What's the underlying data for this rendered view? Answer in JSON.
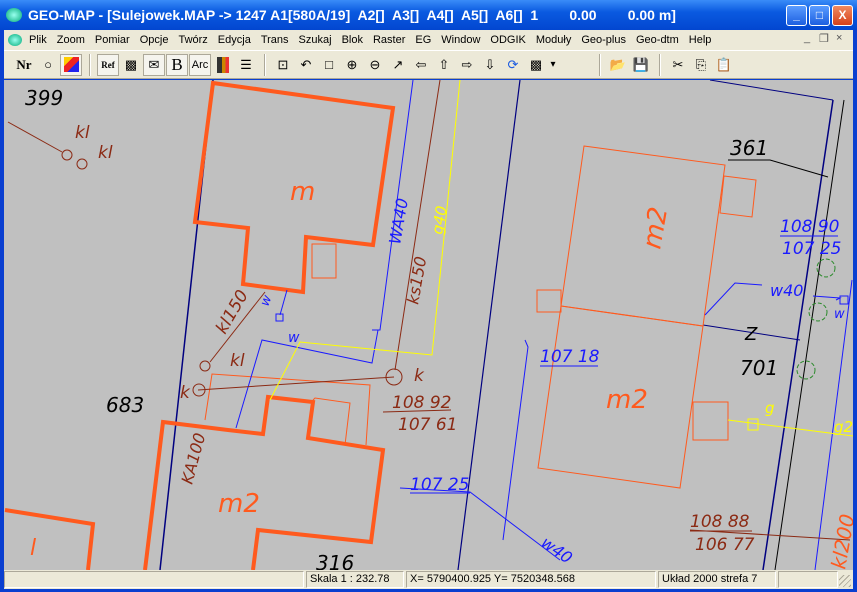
{
  "window": {
    "title": "GEO-MAP - [Sulejowek.MAP -> 1247 A1[580A/19]  A2[]  A3[]  A4[]  A5[]  A6[]  1        0.00        0.00 m]",
    "minimize": "_",
    "maximize": "□",
    "close": "X"
  },
  "menu": {
    "items": [
      "Plik",
      "Zoom",
      "Pomiar",
      "Opcje",
      "Twórz",
      "Edycja",
      "Trans",
      "Szukaj",
      "Blok",
      "Raster",
      "EG",
      "Window",
      "ODGIK",
      "Moduły",
      "Geo-plus",
      "Geo-dtm",
      "Help"
    ],
    "mdi_min": "_",
    "mdi_restore": "❐",
    "mdi_close": "×"
  },
  "toolbar": {
    "nr": "Nr",
    "circle": "○",
    "ref": "Ref",
    "checker": "▩",
    "envelope": "✉",
    "bold": "B",
    "arc": "Arc",
    "layers": "☰",
    "zoom_all": "⊡",
    "zoom_prev": "↶",
    "rect": "□",
    "zoom_in": "⊕",
    "zoom_out": "⊖",
    "pointer": "↗",
    "left": "⇦",
    "up": "⇧",
    "right": "⇨",
    "down": "⇩",
    "refresh": "⟳",
    "pattern": "▩",
    "dropdown": "▾",
    "open": "📂",
    "save": "💾",
    "cut": "✂",
    "copy": "⎘",
    "paste": "📋"
  },
  "map": {
    "labels": {
      "p399": "399",
      "kl1": "kl",
      "kl2": "kl",
      "m": "m",
      "wa40": "WA40",
      "ks150": "ks150",
      "g40": "g40",
      "kl150": "kl150",
      "w1": "w",
      "w2": "w",
      "kl3": "kl",
      "k1": "k",
      "k2": "k",
      "p683": "683",
      "h1a": "108 92",
      "h1b": "107 61",
      "ka100": "KA100",
      "m2a": "m2",
      "l": "l",
      "p316": "316",
      "p361": "361",
      "m2b": "m2",
      "h2a": "108 90",
      "h2b": "107 25",
      "w40a": "w40",
      "w3": "w",
      "z": "Z",
      "p701": "701",
      "h3": "107 18",
      "m2c": "m2",
      "g": "g",
      "g2": "g2",
      "h4": "107 25",
      "w40b": "w40",
      "h5a": "108 88",
      "h5b": "106 77",
      "kl200": "kl200"
    },
    "colors": {
      "building": "#ff5a1e",
      "water": "#1a1aff",
      "sewer": "#8b2a14",
      "gas": "#ffff00",
      "boundary": "#000080",
      "text": "#000000",
      "green": "#2a8a2a"
    }
  },
  "status": {
    "scale": "Skala 1 : 232.78",
    "coords": "X=  5790400.925  Y=  7520348.568",
    "system": "Układ 2000 strefa 7"
  }
}
